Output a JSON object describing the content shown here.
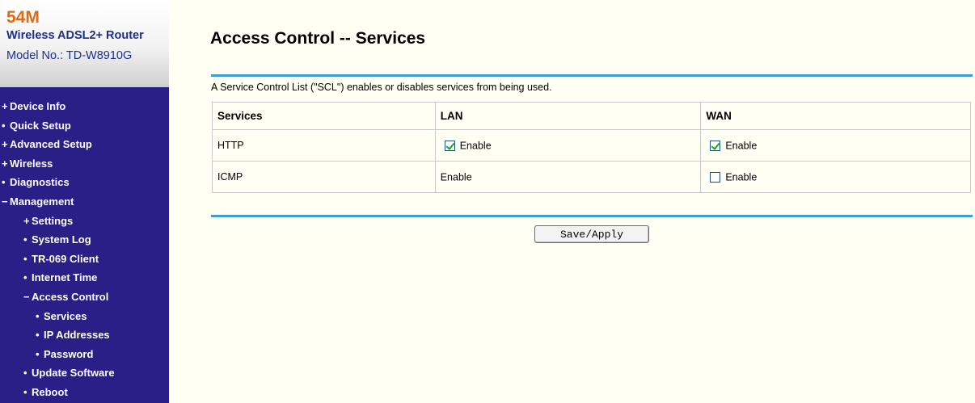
{
  "brand": {
    "speed": "54M",
    "product": "Wireless ADSL2+ Router",
    "model": "Model No.: TD-W8910G"
  },
  "nav": [
    {
      "mark": "+",
      "label": "Device Info"
    },
    {
      "mark": "•",
      "label": "Quick Setup"
    },
    {
      "mark": "+",
      "label": "Advanced Setup"
    },
    {
      "mark": "+",
      "label": "Wireless"
    },
    {
      "mark": "•",
      "label": "Diagnostics"
    },
    {
      "mark": "−",
      "label": "Management"
    },
    {
      "mark": "+",
      "label": "Settings"
    },
    {
      "mark": "•",
      "label": "System Log"
    },
    {
      "mark": "•",
      "label": "TR-069 Client"
    },
    {
      "mark": "•",
      "label": "Internet Time"
    },
    {
      "mark": "−",
      "label": "Access Control"
    },
    {
      "mark": "•",
      "label": "Services"
    },
    {
      "mark": "•",
      "label": "IP Addresses"
    },
    {
      "mark": "•",
      "label": "Password"
    },
    {
      "mark": "•",
      "label": "Update Software"
    },
    {
      "mark": "•",
      "label": "Reboot"
    }
  ],
  "page": {
    "title": "Access Control -- Services",
    "description": "A Service Control List (\"SCL\") enables or disables services from being used."
  },
  "table": {
    "headers": [
      "Services",
      "LAN",
      "WAN"
    ],
    "rows": [
      {
        "service": "HTTP",
        "lan": {
          "label": "Enable",
          "has_checkbox": true,
          "checked": true
        },
        "wan": {
          "label": "Enable",
          "has_checkbox": true,
          "checked": true
        }
      },
      {
        "service": "ICMP",
        "lan": {
          "label": "Enable",
          "has_checkbox": false,
          "checked": false
        },
        "wan": {
          "label": "Enable",
          "has_checkbox": true,
          "checked": false
        }
      }
    ]
  },
  "actions": {
    "save_label": "Save/Apply"
  },
  "colors": {
    "sidebar": "#2a1f86",
    "brand_speed": "#e06a13",
    "brand_text": "#1d2f88",
    "content_bg": "#fffff3",
    "rule": "#3b9fd3",
    "check": "#21a121"
  }
}
